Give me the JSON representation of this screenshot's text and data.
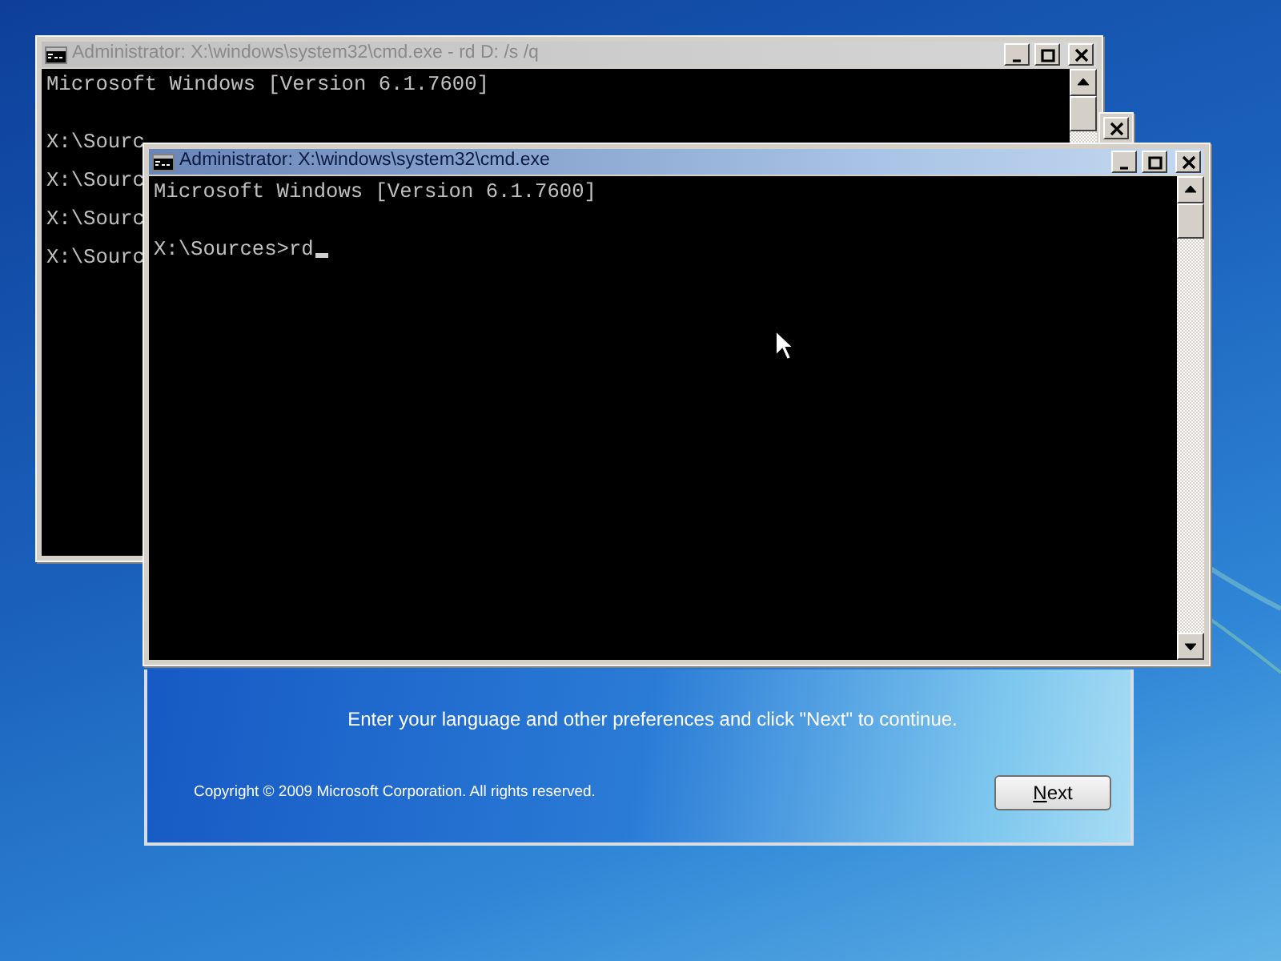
{
  "setup": {
    "message": "Enter your language and other preferences and click \"Next\" to continue.",
    "copyright": "Copyright © 2009 Microsoft Corporation. All rights reserved.",
    "next_button": "Next"
  },
  "windows": [
    {
      "kind": "console",
      "title": "Administrator: X:\\windows\\system32\\cmd.exe - rd  D: /s /q",
      "active": false,
      "lines": [
        "Microsoft Windows [Version 6.1.7600]",
        "X:\\Sourc",
        "X:\\Sourc",
        "X:\\Sourc",
        "X:\\Sourc"
      ]
    },
    {
      "kind": "peek",
      "active": false
    },
    {
      "kind": "console",
      "title": "Administrator: X:\\windows\\system32\\cmd.exe",
      "active": true,
      "caret": true,
      "lines": [
        "Microsoft Windows [Version 6.1.7600]",
        "X:\\Sources>rd"
      ]
    }
  ]
}
